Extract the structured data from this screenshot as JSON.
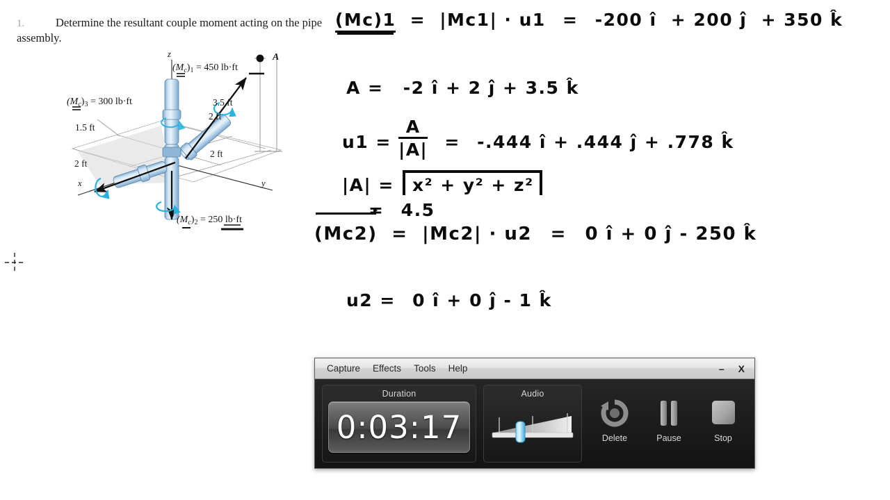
{
  "problem": {
    "number": "1.",
    "text": "Determine the resultant couple moment acting on the pipe assembly."
  },
  "figure": {
    "labels": {
      "m1": "(Mc)1 = 450 lb·ft",
      "m2": "(Mc)2 = 250 lb·ft",
      "m3": "(Mc)3 = 300 lb·ft",
      "dim_3_5ft": "3.5 ft",
      "dim_2ft_upper": "2 ft",
      "dim_2ft_lower": "2 ft",
      "dim_1_5ft": "1.5 ft",
      "dim_2ft_left": "2 ft",
      "point_a": "A",
      "axis_x": "x",
      "axis_y": "y",
      "axis_z": "z"
    },
    "colors": {
      "pipe": "#b7d3ea",
      "pipe_dark": "#6f9dc4",
      "arc_arrow": "#29b4e0",
      "ground": "#d9d9d9"
    }
  },
  "handwriting": {
    "line1": {
      "lhs": "(Mc)1",
      "eq1": "=",
      "mid": "|Mc1| · u1",
      "eq2": "=",
      "rhs_i": "-200 î",
      "rhs_j": "+ 200 ĵ",
      "rhs_k": "+ 350 k̂"
    },
    "line2": {
      "lhs": "A =",
      "rhs": "-2 î + 2 ĵ + 3.5 k̂"
    },
    "line3": {
      "lhs": "u1 =",
      "frac_num": "A",
      "frac_den": "|A|",
      "eq": "=",
      "rhs": "-.444 î + .444 ĵ + .778 k̂"
    },
    "line4": {
      "lhs": "|A| =",
      "radicand": "x² + y² + z²",
      "result_eq": "=",
      "result": "4.5"
    },
    "line5": {
      "lhs": "(Mc2)",
      "eq1": "=",
      "mid": "|Mc2| · u2",
      "eq2": "=",
      "rhs": "0 î + 0 ĵ - 250 k̂"
    },
    "line6": {
      "lhs": "u2 =",
      "rhs": "0 î + 0 ĵ - 1 k̂"
    }
  },
  "recorder": {
    "menu": [
      {
        "label": "Capture"
      },
      {
        "label": "Effects"
      },
      {
        "label": "Tools"
      },
      {
        "label": "Help"
      }
    ],
    "window_buttons": {
      "minimize": "–",
      "close": "X"
    },
    "duration": {
      "title": "Duration",
      "value": "0:03:17"
    },
    "audio": {
      "title": "Audio",
      "level_percent": 36
    },
    "controls": [
      {
        "label": "Delete",
        "icon": "undo-circle-icon"
      },
      {
        "label": "Pause",
        "icon": "pause-bars-icon"
      },
      {
        "label": "Stop",
        "icon": "stop-square-icon"
      }
    ],
    "colors": {
      "panel_bg": "#1c1c1c",
      "titlebar": "#e4e4e4",
      "accent": "#4fc3f7"
    }
  },
  "cursor": {
    "type": "crosshair"
  }
}
